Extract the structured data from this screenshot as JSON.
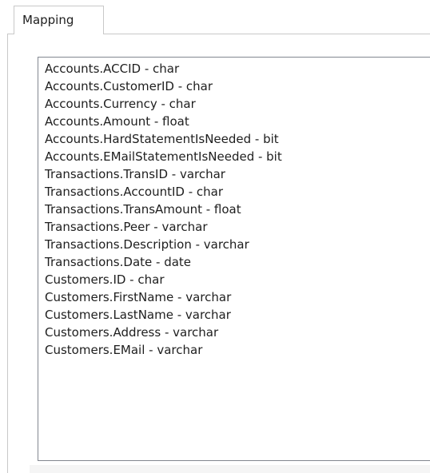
{
  "tab": {
    "label": "Mapping"
  },
  "mapping_list": {
    "items": [
      "Accounts.ACCID - char",
      "Accounts.CustomerID - char",
      "Accounts.Currency - char",
      "Accounts.Amount - float",
      "Accounts.HardStatementIsNeeded - bit",
      "Accounts.EMailStatementIsNeeded - bit",
      "Transactions.TransID - varchar",
      "Transactions.AccountID - char",
      "Transactions.TransAmount - float",
      "Transactions.Peer - varchar",
      "Transactions.Description - varchar",
      "Transactions.Date - date",
      "Customers.ID - char",
      "Customers.FirstName - varchar",
      "Customers.LastName - varchar",
      "Customers.Address - varchar",
      "Customers.EMail - varchar"
    ]
  },
  "colors": {
    "border": "#c8c8c8",
    "listbox_border": "#828790",
    "text": "#1e1e1e"
  }
}
